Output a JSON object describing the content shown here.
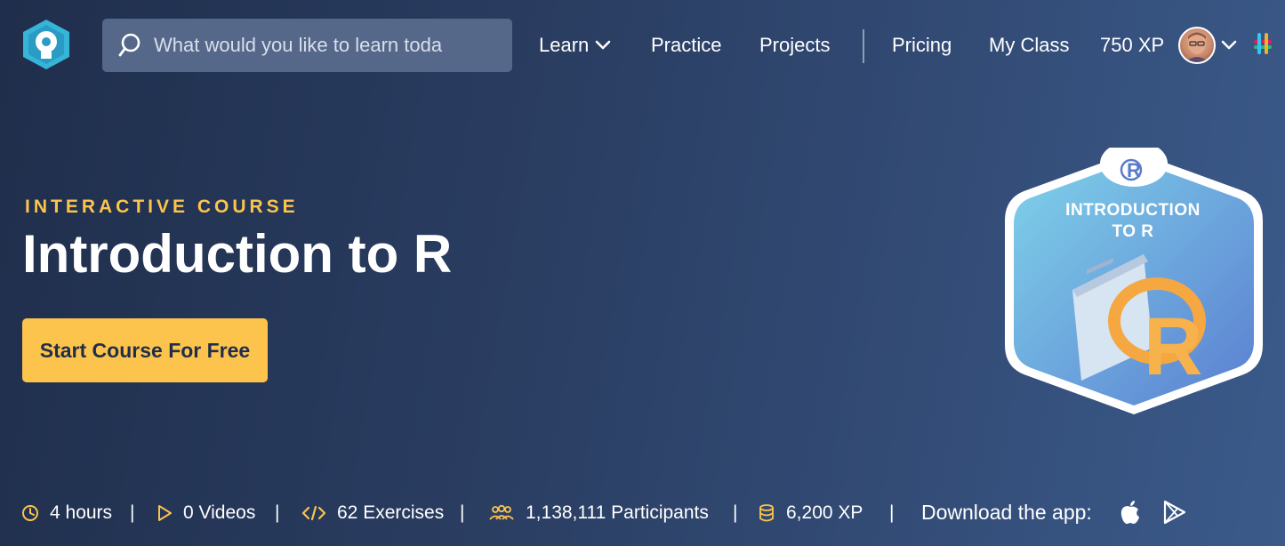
{
  "colors": {
    "accent": "#fcc44d",
    "background_start": "#1f2e4b",
    "background_end": "#3b5a8a",
    "search_bg": "#56688a"
  },
  "nav": {
    "logo_icon": "datacamp-logo-icon",
    "search": {
      "placeholder": "What would you like to learn toda",
      "icon": "search-icon"
    },
    "links": {
      "learn": "Learn",
      "practice": "Practice",
      "projects": "Projects",
      "pricing": "Pricing",
      "my_class": "My Class"
    },
    "xp": "750 XP",
    "avatar_icon": "user-avatar",
    "slack_icon": "slack-icon"
  },
  "hero": {
    "eyebrow": "INTERACTIVE COURSE",
    "title": "Introduction to R",
    "cta": "Start Course For Free"
  },
  "badge": {
    "line1": "INTRODUCTION",
    "line2": "TO R",
    "icon": "r-course-badge"
  },
  "stats": {
    "hours": "4 hours",
    "videos": "0 Videos",
    "exercises": "62 Exercises",
    "participants": "1,138,111 Participants",
    "xp": "6,200 XP",
    "separator": "|",
    "download": "Download the app:"
  }
}
